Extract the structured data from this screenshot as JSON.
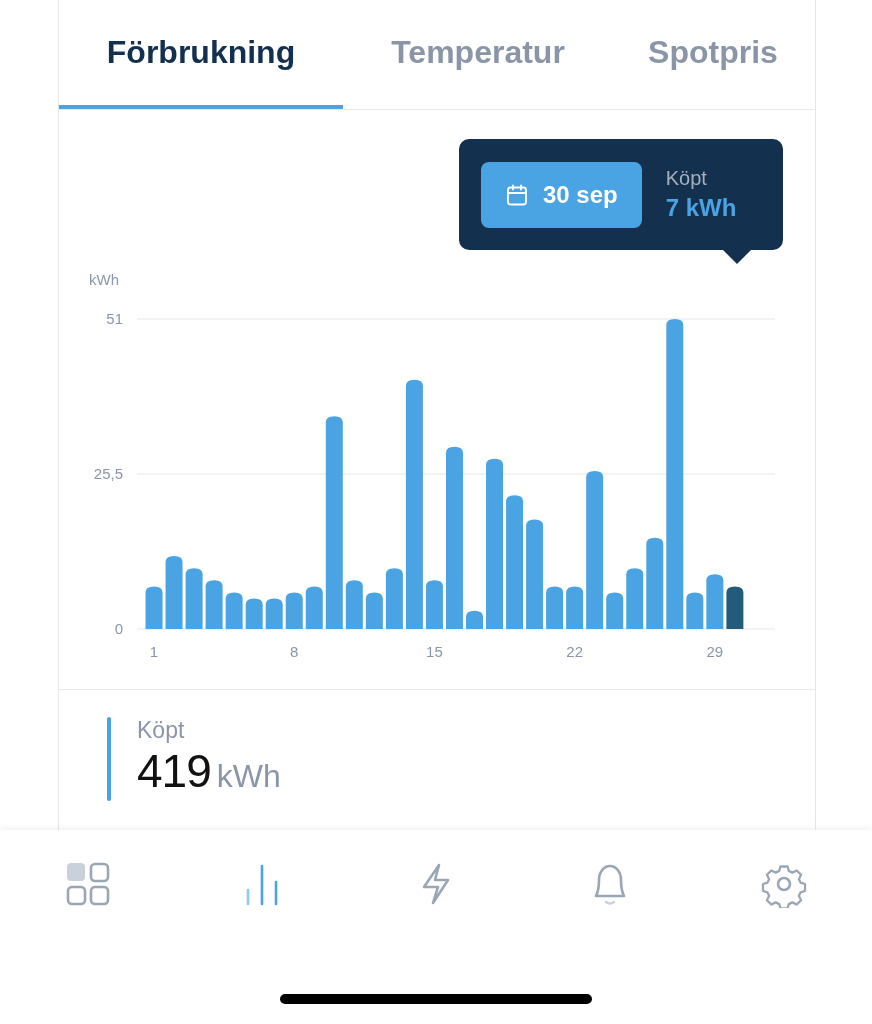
{
  "tabs": [
    {
      "label": "Förbrukning",
      "selected": true
    },
    {
      "label": "Temperatur",
      "selected": false
    },
    {
      "label": "Spotpris",
      "selected": false
    }
  ],
  "tooltip": {
    "date": "30 sep",
    "label": "Köpt",
    "value": "7 kWh"
  },
  "chart": {
    "chart_data": {
      "type": "bar",
      "ylabel": "kWh",
      "x": [
        1,
        2,
        3,
        4,
        5,
        6,
        7,
        8,
        9,
        10,
        11,
        12,
        13,
        14,
        15,
        16,
        17,
        18,
        19,
        20,
        21,
        22,
        23,
        24,
        25,
        26,
        27,
        28,
        29,
        30
      ],
      "stacked": true,
      "series": [
        {
          "color": "#4aa3e2",
          "values": [
            7,
            12,
            10,
            8,
            6,
            5,
            5,
            6,
            7,
            35,
            8,
            6,
            10,
            41,
            8,
            30,
            3,
            28,
            22,
            18,
            7,
            7,
            26,
            6,
            10,
            15,
            51,
            6,
            9,
            null
          ]
        },
        {
          "color": "#235b7b",
          "values": [
            null,
            null,
            null,
            null,
            null,
            null,
            null,
            null,
            null,
            null,
            null,
            null,
            null,
            null,
            null,
            null,
            null,
            null,
            null,
            null,
            null,
            null,
            null,
            null,
            null,
            null,
            null,
            null,
            null,
            7
          ]
        }
      ],
      "ylim": [
        0,
        51
      ],
      "yticks": [
        0,
        {
          "value": 25.5,
          "label": "25,5"
        },
        51
      ],
      "xlim": [
        0.5,
        30.5
      ],
      "xticks": [
        1,
        8,
        15,
        22,
        29
      ]
    }
  },
  "summary": {
    "label": "Köpt",
    "value": "419",
    "unit": "kWh"
  },
  "nav": [
    {
      "kind": "grid",
      "selected": false
    },
    {
      "kind": "bars",
      "selected": true
    },
    {
      "kind": "bolt",
      "selected": false
    },
    {
      "kind": "bell",
      "selected": false
    },
    {
      "kind": "gear",
      "selected": false
    }
  ]
}
